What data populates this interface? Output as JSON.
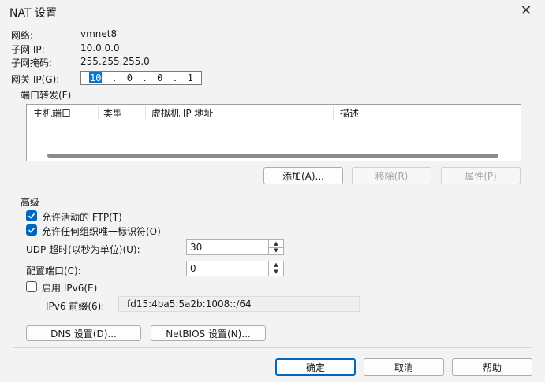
{
  "window": {
    "title": "NAT 设置"
  },
  "info": {
    "network_label": "网络:",
    "network_value": "vmnet8",
    "subnet_ip_label": "子网 IP:",
    "subnet_ip_value": "10.0.0.0",
    "subnet_mask_label": "子网掩码:",
    "subnet_mask_value": "255.255.255.0",
    "gateway_label": "网关 IP(G):",
    "gateway_octets": [
      "10",
      ".",
      "0",
      ".",
      "0",
      ".",
      "1"
    ]
  },
  "port_forwarding": {
    "group_label": "端口转发(F)",
    "columns": [
      "主机端口",
      "类型",
      "虚拟机 IP 地址",
      "描述"
    ],
    "rows": [],
    "add_label": "添加(A)...",
    "remove_label": "移除(R)",
    "properties_label": "属性(P)"
  },
  "advanced": {
    "group_label": "高级",
    "allow_ftp_label": "允许活动的 FTP(T)",
    "allow_ftp_checked": true,
    "allow_uid_label": "允许任何组织唯一标识符(O)",
    "allow_uid_checked": true,
    "udp_timeout_label": "UDP 超时(以秒为单位)(U):",
    "udp_timeout_value": "30",
    "config_port_label": "配置端口(C):",
    "config_port_value": "0",
    "enable_ipv6_label": "启用 IPv6(E)",
    "enable_ipv6_checked": false,
    "ipv6_prefix_label": "IPv6 前缀(6):",
    "ipv6_prefix_value": "fd15:4ba5:5a2b:1008::/64",
    "dns_settings_label": "DNS 设置(D)...",
    "netbios_settings_label": "NetBIOS 设置(N)..."
  },
  "footer": {
    "ok_label": "确定",
    "cancel_label": "取消",
    "help_label": "帮助"
  },
  "colors": {
    "accent": "#0067c0",
    "selection": "#0078d7"
  }
}
